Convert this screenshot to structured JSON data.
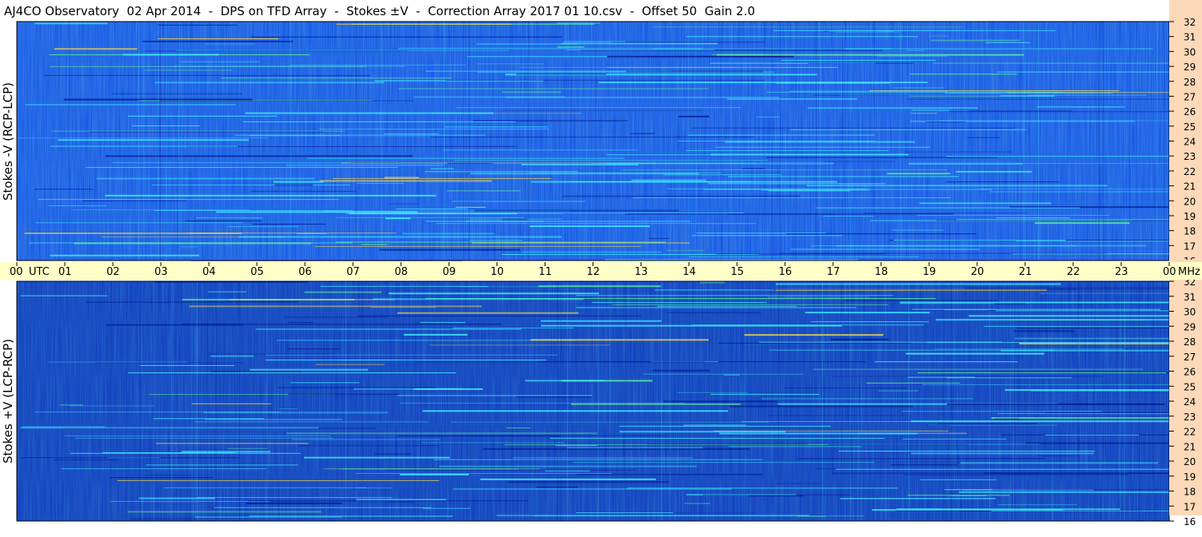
{
  "title": "AJ4CO Observatory  02 Apr 2014  -  DPS on TFD Array  -  Stokes ±V  -  Correction Array 2017 01 10.csv  -  Offset 50  Gain 2.0",
  "colors": {
    "time_axis_bg": "#ffffc8",
    "freq_axis_bg": "#fdd9b9",
    "spectrogram_base": "#0a4de6",
    "spectrogram_dark": "#001a8c",
    "spectrogram_bright": "#40f0ff",
    "spectrogram_hot": "#ffe040"
  },
  "chart_data": [
    {
      "type": "heatmap",
      "panel": "top",
      "ylabel": "Stokes -V (RCP-LCP)",
      "y_unit": "MHz",
      "ylim": [
        16,
        32
      ],
      "x_unit": "UTC",
      "xlim": [
        0,
        24
      ],
      "yticks": [
        "32",
        "31",
        "30",
        "29",
        "28",
        "27",
        "26",
        "25",
        "24",
        "23",
        "22",
        "21",
        "20",
        "19",
        "18",
        "17",
        "16"
      ]
    },
    {
      "type": "heatmap",
      "panel": "bottom",
      "ylabel": "Stokes +V (LCP-RCP)",
      "y_unit": "MHz",
      "ylim": [
        16,
        32
      ],
      "x_unit": "UTC",
      "xlim": [
        0,
        24
      ],
      "yticks": [
        "32",
        "31",
        "30",
        "29",
        "28",
        "27",
        "26",
        "25",
        "24",
        "23",
        "22",
        "21",
        "20",
        "19",
        "18",
        "17",
        "16"
      ]
    }
  ],
  "time_axis": {
    "labels": [
      "00",
      "01",
      "02",
      "03",
      "04",
      "05",
      "06",
      "07",
      "08",
      "09",
      "10",
      "11",
      "12",
      "13",
      "14",
      "15",
      "16",
      "17",
      "18",
      "19",
      "20",
      "21",
      "22",
      "23",
      "00"
    ],
    "utc_label": "UTC",
    "mhz_label": "MHz"
  }
}
